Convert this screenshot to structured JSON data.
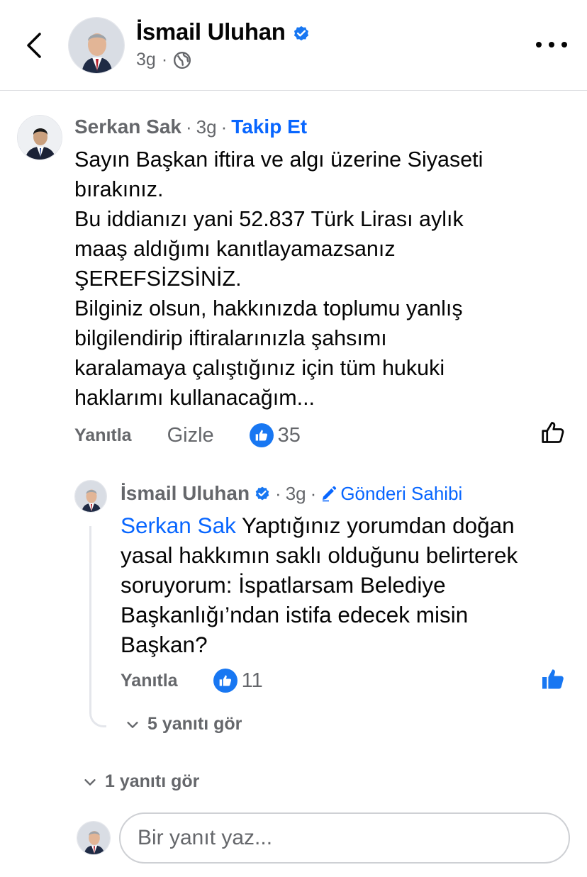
{
  "header": {
    "name": "İsmail Uluhan",
    "time": "3g",
    "separator": "·",
    "back_icon": "chevron-left-icon",
    "more_icon": "ellipsis-icon",
    "privacy_icon": "globe-icon"
  },
  "comment": {
    "author": "Serkan Sak",
    "time": "3g",
    "follow_label": "Takip Et",
    "lines": [
      "Sayın Başkan iftira ve algı üzerine Siyaseti",
      "bırakınız.",
      "Bu iddianızı yani 52.837 Türk Lirası aylık",
      "maaş aldığımı kanıtlayamazsanız",
      "ŞEREFSİZSİNİZ.",
      "Bilginiz olsun, hakkınızda toplumu yanlış",
      "bilgilendirip iftiralarınızla şahsımı",
      "karalamaya çalıştığınız için  tüm hukuki",
      "haklarımı kullanacağım..."
    ],
    "reply_label": "Yanıtla",
    "hide_label": "Gizle",
    "like_count": "35"
  },
  "reply": {
    "author": "İsmail Uluhan",
    "time": "3g",
    "owner_label": "Gönderi Sahibi",
    "mention": "Serkan Sak",
    "lines": [
      " Yaptığınız yorumdan doğan",
      "yasal hakkımın saklı olduğunu belirterek",
      "soruyorum: İspatlarsam Belediye",
      "Başkanlığı’ndan istifa edecek misin",
      "Başkan?"
    ],
    "reply_label": "Yanıtla",
    "like_count": "11",
    "see_more_label": "5 yanıtı gör"
  },
  "see_more_label": "1 yanıtı gör",
  "composer": {
    "placeholder": "Bir yanıt yaz..."
  },
  "colors": {
    "accent": "#0866ff",
    "like_blue": "#1877f2",
    "muted": "#65676b",
    "text": "#050505"
  }
}
